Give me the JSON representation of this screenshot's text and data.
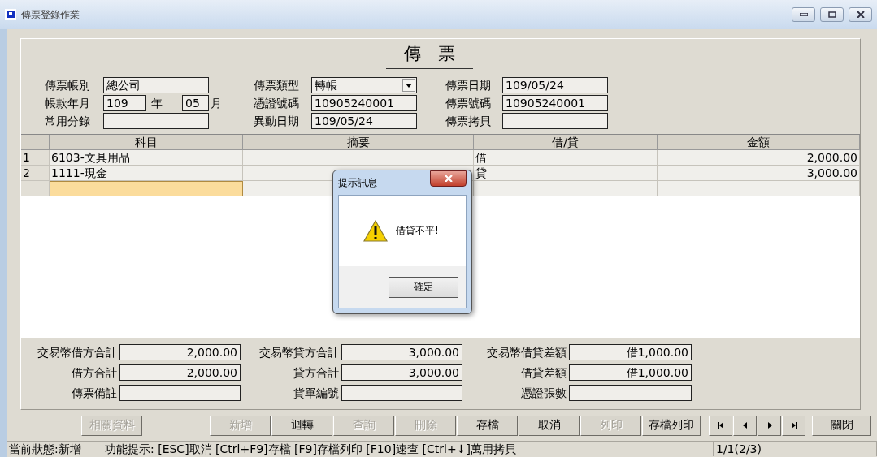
{
  "window": {
    "title": "傳票登錄作業"
  },
  "voucher_title": "傳　票",
  "header_fields": [
    {
      "kind": "text",
      "label": "傳票帳別",
      "value": "總公司"
    },
    {
      "kind": "dropdown",
      "label": "傳票類型",
      "value": "轉帳"
    },
    {
      "kind": "text",
      "label": "傳票日期",
      "value": "109/05/24"
    },
    {
      "kind": "year_month",
      "label": "帳款年月",
      "year": "109",
      "year_unit": "年",
      "month": "05",
      "month_unit": "月"
    },
    {
      "kind": "text",
      "label": "憑證號碼",
      "value": "10905240001"
    },
    {
      "kind": "text",
      "label": "傳票號碼",
      "value": "10905240001"
    },
    {
      "kind": "text",
      "label": "常用分錄"
    },
    {
      "kind": "text",
      "label": "異動日期",
      "value": "109/05/24"
    },
    {
      "kind": "text",
      "label": "傳票拷貝"
    }
  ],
  "table": {
    "columns": [
      "科目",
      "摘要",
      "借/貸",
      "金額"
    ],
    "rows": [
      {
        "number": "1",
        "account": "6103-文具用品",
        "debit_credit": "借",
        "amount": "2,000.00",
        "selected": false
      },
      {
        "number": "2",
        "account": "1111-現金",
        "debit_credit": "貸",
        "amount": "3,000.00",
        "selected": false
      },
      {
        "selected": true
      }
    ]
  },
  "totals": [
    {
      "label": "交易幣借方合計",
      "value": "2,000.00"
    },
    {
      "label": "交易幣貸方合計",
      "value": "3,000.00"
    },
    {
      "label": "交易幣借貸差額",
      "value": "借1,000.00"
    },
    {
      "label": "借方合計",
      "value": "2,000.00"
    },
    {
      "label": "貸方合計",
      "value": "3,000.00"
    },
    {
      "label": "借貸差額",
      "value": "借1,000.00"
    },
    {
      "label": "傳票備註"
    },
    {
      "label": "貨單編號"
    },
    {
      "label": "憑證張數"
    }
  ],
  "related_button": {
    "label": "相關資料",
    "disabled": true
  },
  "buttons": [
    {
      "label": "新增",
      "disabled": true
    },
    {
      "label": "迴轉",
      "disabled": false
    },
    {
      "label": "查詢",
      "disabled": true
    },
    {
      "label": "刪除",
      "disabled": true
    },
    {
      "label": "存檔",
      "disabled": false
    },
    {
      "label": "取消",
      "disabled": false
    },
    {
      "label": "列印",
      "disabled": true
    },
    {
      "label": "存檔列印",
      "disabled": false
    }
  ],
  "nav_buttons": [
    {
      "kind": "first"
    },
    {
      "kind": "prev"
    },
    {
      "kind": "next"
    },
    {
      "kind": "last"
    }
  ],
  "close_button": "關閉",
  "status_bar": {
    "state": "當前狀態:新增",
    "hint": "功能提示: [ESC]取消 [Ctrl+F9]存檔 [F9]存檔列印 [F10]速查 [Ctrl+↓]萬用拷貝",
    "record": "1/1(2/3)"
  },
  "dialog": {
    "title": "提示訊息",
    "message": "借貸不平!",
    "button": "確定"
  }
}
